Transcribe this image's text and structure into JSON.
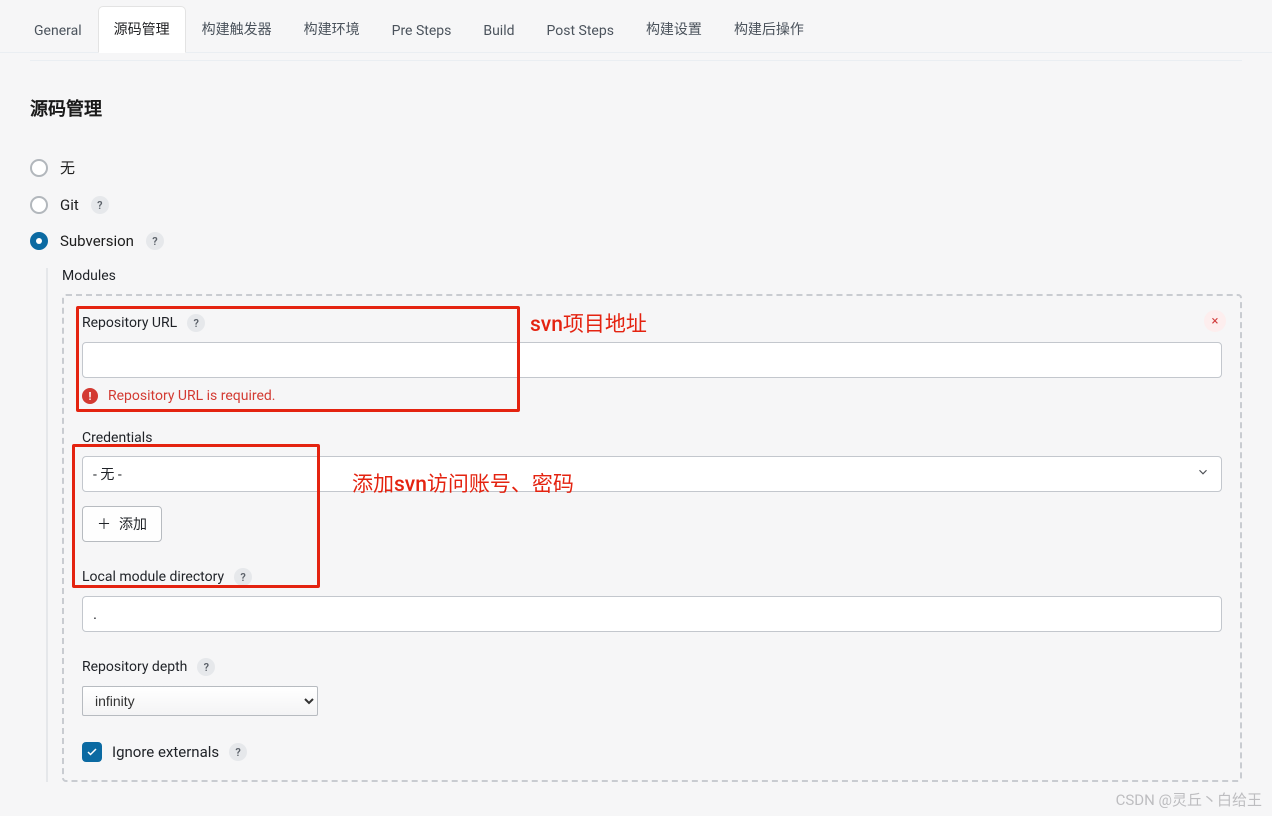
{
  "tabs": [
    {
      "label": "General"
    },
    {
      "label": "源码管理"
    },
    {
      "label": "构建触发器"
    },
    {
      "label": "构建环境"
    },
    {
      "label": "Pre Steps"
    },
    {
      "label": "Build"
    },
    {
      "label": "Post Steps"
    },
    {
      "label": "构建设置"
    },
    {
      "label": "构建后操作"
    }
  ],
  "activeTabIndex": 1,
  "section_title": "源码管理",
  "scm_options": {
    "none": "无",
    "git": "Git",
    "subversion": "Subversion",
    "selected": "subversion"
  },
  "modules_label": "Modules",
  "repo_url": {
    "label": "Repository URL",
    "value": "",
    "error": "Repository URL is required."
  },
  "credentials": {
    "label": "Credentials",
    "selected": "- 无 -",
    "add_label": "添加"
  },
  "local_dir": {
    "label": "Local module directory",
    "value": "."
  },
  "depth": {
    "label": "Repository depth",
    "value": "infinity"
  },
  "ignore_externals": {
    "label": "Ignore externals",
    "checked": true
  },
  "annotations": {
    "repo": "svn项目地址",
    "cred": "添加svn访问账号、密码"
  },
  "help_glyph": "?",
  "close_glyph": "×",
  "plus_glyph": "＋",
  "watermark": "CSDN @灵丘丶白给王"
}
